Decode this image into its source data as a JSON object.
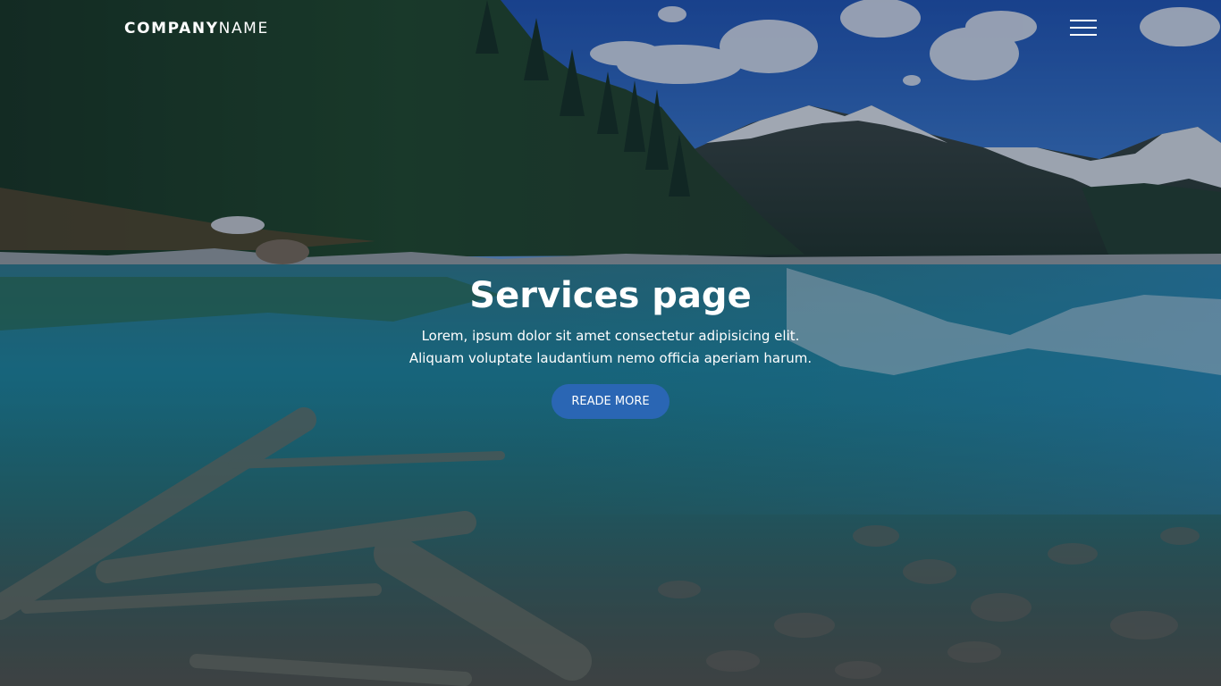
{
  "navbar": {
    "brand_bold": "COMPANY",
    "brand_light": "NAME",
    "menu_icon": "hamburger-menu-icon"
  },
  "hero": {
    "title": "Services page",
    "subtitle_line1": "Lorem, ipsum dolor sit amet consectetur adipisicing elit.",
    "subtitle_line2": "Aliquam voluptate laudantium nemo officia aperiam harum.",
    "cta_label": "READE MORE"
  },
  "colors": {
    "cta_background": "#2a66b4",
    "text": "#ffffff",
    "overlay": "#0c1630"
  }
}
